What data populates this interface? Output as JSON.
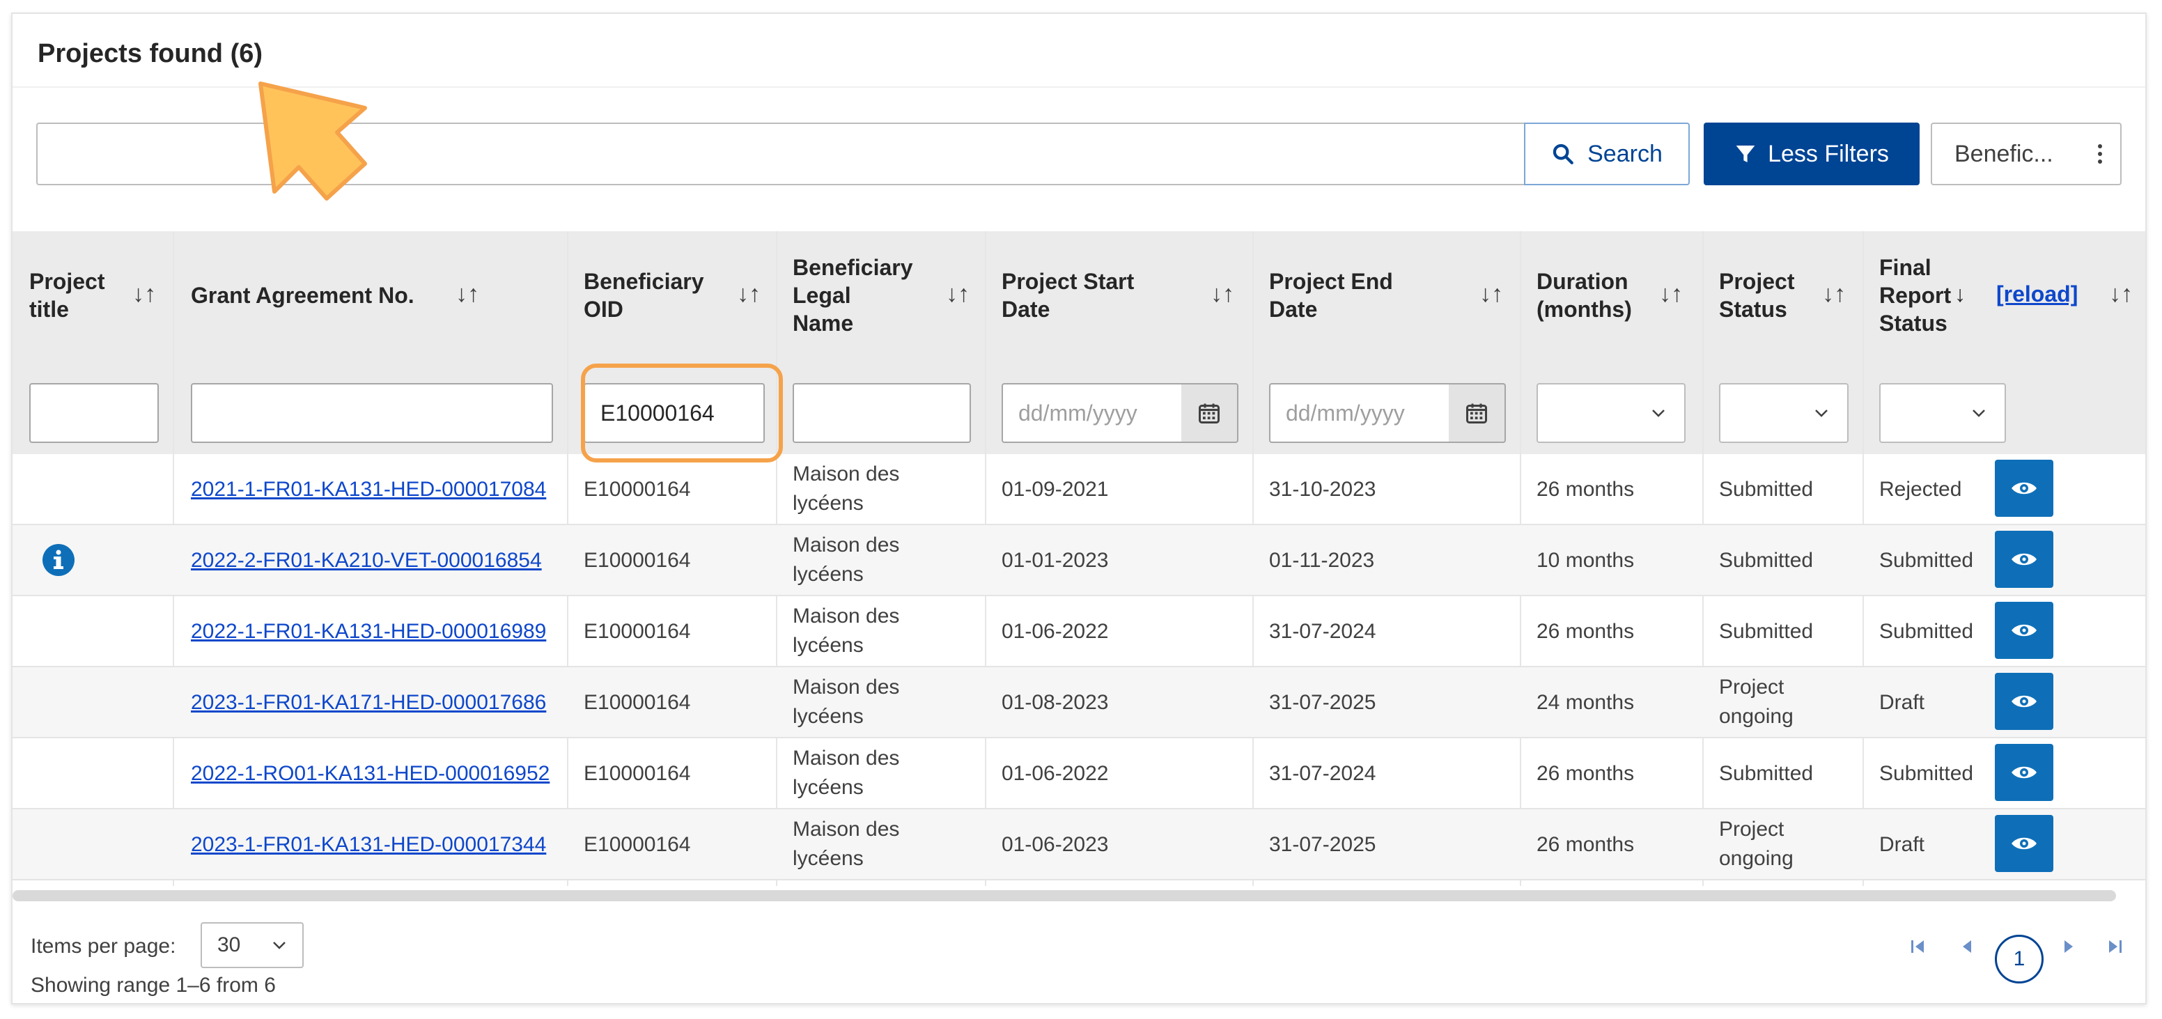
{
  "header": {
    "title": "Projects found (6)"
  },
  "toolbar": {
    "search_value": "",
    "search_label": "Search",
    "filters_label": "Less Filters",
    "column_menu_label": "Benefic..."
  },
  "table": {
    "columns": [
      {
        "key": "project_title",
        "label": "Project\ntitle"
      },
      {
        "key": "grant_agreement",
        "label": "Grant Agreement No."
      },
      {
        "key": "beneficiary_oid",
        "label": "Beneficiary\nOID"
      },
      {
        "key": "legal_name",
        "label": "Beneficiary\nLegal\nName"
      },
      {
        "key": "start_date",
        "label": "Project Start\nDate"
      },
      {
        "key": "end_date",
        "label": "Project End\nDate"
      },
      {
        "key": "duration",
        "label": "Duration\n(months)"
      },
      {
        "key": "status",
        "label": "Project\nStatus"
      },
      {
        "key": "final_report",
        "label": "Final\nReport\nStatus",
        "sort_indicator": "↓",
        "extra_link": "[reload]"
      }
    ],
    "filters": {
      "project_title": "",
      "grant_agreement": "",
      "beneficiary_oid": "E10000164",
      "legal_name": "",
      "start_date_placeholder": "dd/mm/yyyy",
      "end_date_placeholder": "dd/mm/yyyy",
      "duration": "",
      "status": "",
      "final_report": ""
    },
    "rows": [
      {
        "info": false,
        "grant": "2021-1-FR01-KA131-HED-000017084",
        "oid": "E10000164",
        "legal_1": "Maison des",
        "legal_2": "lycéens",
        "start": "01-09-2021",
        "end": "31-10-2023",
        "duration": "26 months",
        "status_1": "Submitted",
        "status_2": "",
        "report": "Rejected"
      },
      {
        "info": true,
        "grant": "2022-2-FR01-KA210-VET-000016854",
        "oid": "E10000164",
        "legal_1": "Maison des",
        "legal_2": "lycéens",
        "start": "01-01-2023",
        "end": "01-11-2023",
        "duration": "10 months",
        "status_1": "Submitted",
        "status_2": "",
        "report": "Submitted"
      },
      {
        "info": false,
        "grant": "2022-1-FR01-KA131-HED-000016989",
        "oid": "E10000164",
        "legal_1": "Maison des",
        "legal_2": "lycéens",
        "start": "01-06-2022",
        "end": "31-07-2024",
        "duration": "26 months",
        "status_1": "Submitted",
        "status_2": "",
        "report": "Submitted"
      },
      {
        "info": false,
        "grant": "2023-1-FR01-KA171-HED-000017686",
        "oid": "E10000164",
        "legal_1": "Maison des",
        "legal_2": "lycéens",
        "start": "01-08-2023",
        "end": "31-07-2025",
        "duration": "24 months",
        "status_1": "Project",
        "status_2": "ongoing",
        "report": "Draft"
      },
      {
        "info": false,
        "grant": "2022-1-RO01-KA131-HED-000016952",
        "oid": "E10000164",
        "legal_1": "Maison des",
        "legal_2": "lycéens",
        "start": "01-06-2022",
        "end": "31-07-2024",
        "duration": "26 months",
        "status_1": "Submitted",
        "status_2": "",
        "report": "Submitted"
      },
      {
        "info": false,
        "grant": "2023-1-FR01-KA131-HED-000017344",
        "oid": "E10000164",
        "legal_1": "Maison des",
        "legal_2": "lycéens",
        "start": "01-06-2023",
        "end": "31-07-2025",
        "duration": "26 months",
        "status_1": "Project",
        "status_2": "ongoing",
        "report": "Draft"
      }
    ]
  },
  "footer": {
    "items_per_page_label": "Items per page:",
    "items_per_page_value": "30",
    "range_text": "Showing range 1–6 from 6",
    "current_page": "1"
  },
  "icons": {
    "search": "search-icon",
    "filter": "filter-icon",
    "menu": "kebab-menu-icon",
    "sort": "sort-icon",
    "calendar": "calendar-icon",
    "chevron": "chevron-down-icon",
    "info": "info-icon",
    "view": "eye-icon",
    "annotation": "arrow-annotation"
  },
  "colors": {
    "primary": "#004494",
    "link": "#0e47cb",
    "view_button": "#0e6fb8",
    "highlight": "#f5a24a",
    "arrow": "#ffc35a"
  }
}
